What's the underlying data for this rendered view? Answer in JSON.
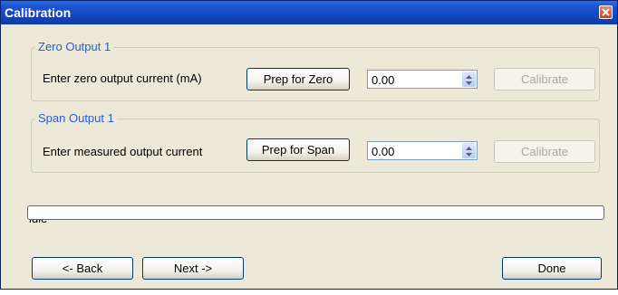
{
  "window": {
    "title": "Calibration"
  },
  "zero_group": {
    "legend": "Zero Output 1",
    "label": "Enter zero output current (mA)",
    "prep_button": "Prep for Zero",
    "value": "0.00",
    "calibrate_button": "Calibrate"
  },
  "span_group": {
    "legend": "Span Output 1",
    "label": "Enter measured output current",
    "prep_button": "Prep for Span",
    "value": "0.00",
    "calibrate_button": "Calibrate"
  },
  "status": {
    "text": "idle",
    "progress": 0
  },
  "footer": {
    "back_button": "<- Back",
    "next_button": "Next ->",
    "done_button": "Done"
  },
  "icons": {
    "close": "close-icon",
    "spin": "spin-arrows-icon"
  }
}
